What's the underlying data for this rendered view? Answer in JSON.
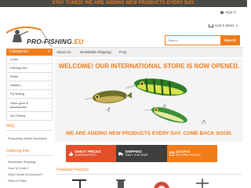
{
  "banner": {
    "text": "STAY TUNED! WE ARE ADDING NEW PRODUCTS EVERY DAY."
  },
  "user": {
    "signin_label": "Sign in"
  },
  "logo": {
    "text_main": "PRO-FISHING",
    "text_dot": ".EU"
  },
  "cart": {
    "label": "Cart 0 Items"
  },
  "search": {
    "placeholder": "Search",
    "button_label": "Search"
  },
  "nav": {
    "items": [
      "About Us",
      "Worldwide Shipping",
      "FAQ"
    ]
  },
  "sidebar": {
    "heading": "Categories",
    "items": [
      {
        "label": "Lures"
      },
      {
        "label": "Fishing Line"
      },
      {
        "label": "Reels"
      },
      {
        "label": "Waders"
      },
      {
        "label": "Fly fishing"
      },
      {
        "label": "Other gear & accessories"
      },
      {
        "label": "Ice Fishing"
      }
    ]
  },
  "faq_block": {
    "title": "FAQ",
    "links": [
      "Frequently Asked Questions"
    ]
  },
  "ordering_block": {
    "title": "Ordering Info",
    "links": [
      "Worldwide Shipping",
      "How To Order?",
      "Why Create An Account?",
      "Return Policy"
    ]
  },
  "hero": {
    "title": "WELCOME! OUR INTERNATIONAL STORE IS NOW OPENED.",
    "subtitle": "WE ARE ADDING NEW PRODUCTS EVERY DAY. COME BACK SOON."
  },
  "features": [
    {
      "title": "GREAT PRICES",
      "subtitle": "GUARANTEED",
      "icon": "thumbs-up-icon",
      "color": "#e2502a"
    },
    {
      "title": "SHIPPING",
      "subtitle": "ONLY 4.90 EUR",
      "icon": "truck-icon",
      "color": "#3e3e3c"
    },
    {
      "title": "14 DAYS",
      "subtitle": "RETURN POLICY",
      "icon": "calendar-icon",
      "color": "#f07c1a"
    }
  ],
  "featured": {
    "title": "Featured Products"
  },
  "colors": {
    "accent": "#f07c1a",
    "dark": "#4a4a46"
  }
}
